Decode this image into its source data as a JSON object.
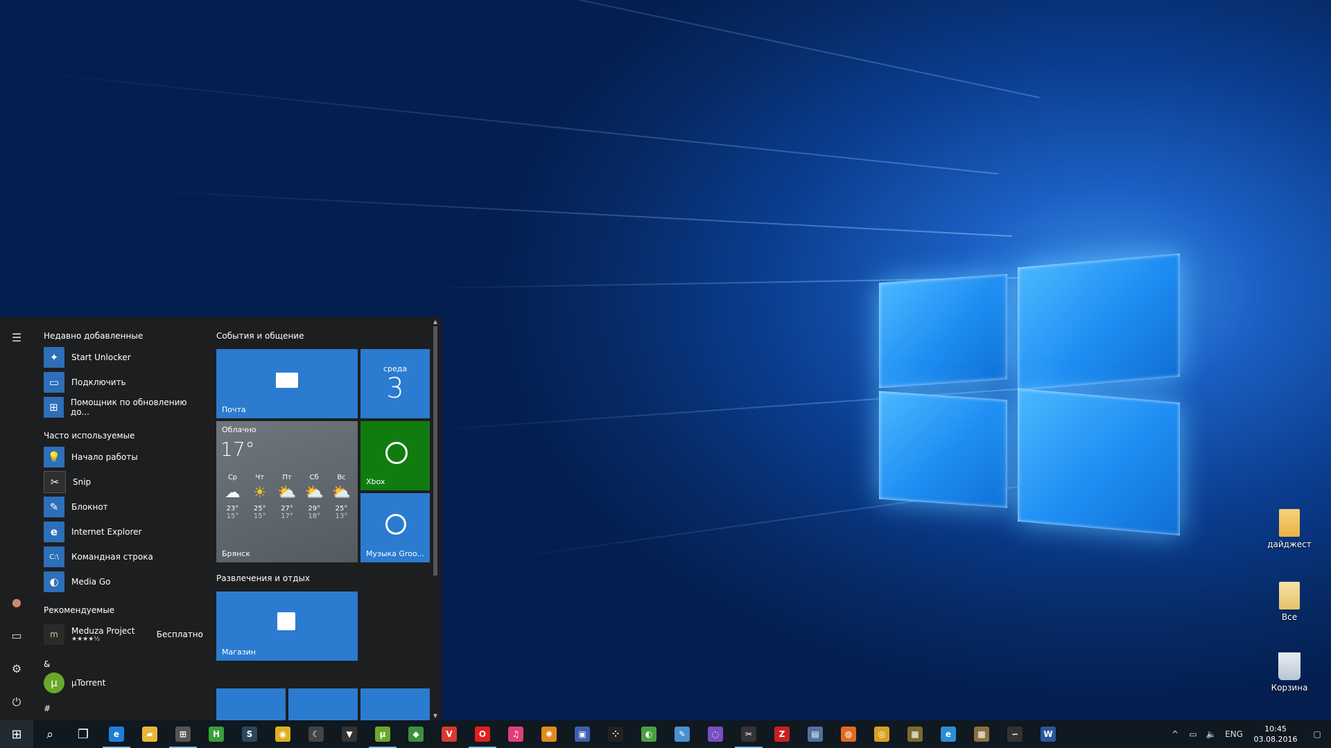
{
  "desktop": {
    "icons": [
      {
        "label": "дайджест",
        "icon": "folder-icon"
      },
      {
        "label": "Все",
        "icon": "folder-docs-icon"
      },
      {
        "label": "Корзина",
        "icon": "recycle-bin-icon"
      }
    ]
  },
  "start_menu": {
    "sections": {
      "recent": "Недавно добавленные",
      "frequent": "Часто используемые",
      "recommended": "Рекомендуемые",
      "amp": "&",
      "hash": "#"
    },
    "recent_apps": [
      {
        "label": "Start Unlocker",
        "icon": "wand-icon",
        "color": "#2d6fb8"
      },
      {
        "label": "Подключить",
        "icon": "connect-icon",
        "color": "#2d6fb8"
      },
      {
        "label": "Помощник по обновлению до...",
        "icon": "windows-icon",
        "color": "#2d6fb8"
      }
    ],
    "frequent_apps": [
      {
        "label": "Начало работы",
        "icon": "lightbulb-icon",
        "color": "#2d6fb8"
      },
      {
        "label": "Snip",
        "icon": "scissors-icon",
        "color": "#2f2f2f"
      },
      {
        "label": "Блокнот",
        "icon": "notepad-icon",
        "color": "#2d6fb8"
      },
      {
        "label": "Internet Explorer",
        "icon": "ie-icon",
        "color": "#2d6fb8"
      },
      {
        "label": "Командная строка",
        "icon": "cmd-icon",
        "color": "#2d6fb8"
      },
      {
        "label": "Media Go",
        "icon": "media-go-icon",
        "color": "#2d6fb8"
      }
    ],
    "recommended_app": {
      "label": "Meduza Project",
      "price": "Бесплатно",
      "rating": "★★★★½"
    },
    "utorrent": {
      "label": "µTorrent"
    },
    "groups": {
      "events": "События и общение",
      "entertainment": "Развлечения и отдых"
    },
    "tiles": {
      "mail": "Почта",
      "calendar_day": "среда",
      "calendar_date": "3",
      "xbox": "Xbox",
      "groove": "Музыка Groo...",
      "store": "Магазин"
    },
    "weather": {
      "condition": "Облачно",
      "temp": "17°",
      "city": "Брянск",
      "days": [
        {
          "d": "Ср",
          "hi": "23°",
          "lo": "15°",
          "icon": "cloud"
        },
        {
          "d": "Чт",
          "hi": "25°",
          "lo": "15°",
          "icon": "sun"
        },
        {
          "d": "Пт",
          "hi": "27°",
          "lo": "17°",
          "icon": "partly"
        },
        {
          "d": "Сб",
          "hi": "29°",
          "lo": "18°",
          "icon": "partly"
        },
        {
          "d": "Вс",
          "hi": "25°",
          "lo": "13°",
          "icon": "partly"
        }
      ]
    }
  },
  "taskbar": {
    "language": "ENG",
    "time": "10:45",
    "date": "03.08.2016",
    "apps": [
      {
        "name": "edge",
        "glyph": "e",
        "color": "#1e7fd8"
      },
      {
        "name": "explorer",
        "glyph": "▰",
        "color": "#e8b73a"
      },
      {
        "name": "store",
        "glyph": "⊞",
        "color": "#555"
      },
      {
        "name": "h-app",
        "glyph": "H",
        "color": "#3a9e3a"
      },
      {
        "name": "steam",
        "glyph": "S",
        "color": "#2a475e"
      },
      {
        "name": "app-duck",
        "glyph": "◉",
        "color": "#e0b020"
      },
      {
        "name": "app-crescent",
        "glyph": "☾",
        "color": "#444"
      },
      {
        "name": "app-fox",
        "glyph": "▼",
        "color": "#333"
      },
      {
        "name": "utorrent",
        "glyph": "µ",
        "color": "#6aa72b"
      },
      {
        "name": "app-green",
        "glyph": "◆",
        "color": "#3f8f3f"
      },
      {
        "name": "vivaldi",
        "glyph": "V",
        "color": "#d83b30"
      },
      {
        "name": "opera",
        "glyph": "O",
        "color": "#e0201f"
      },
      {
        "name": "itunes",
        "glyph": "♫",
        "color": "#e0407a"
      },
      {
        "name": "app-gear",
        "glyph": "✺",
        "color": "#e08a20"
      },
      {
        "name": "app-monitor",
        "glyph": "▣",
        "color": "#3a5fb0"
      },
      {
        "name": "blackberry",
        "glyph": "⁘",
        "color": "#222"
      },
      {
        "name": "media-go",
        "glyph": "◐",
        "color": "#4aa040"
      },
      {
        "name": "notepad",
        "glyph": "✎",
        "color": "#4a8fd0"
      },
      {
        "name": "tor",
        "glyph": "◌",
        "color": "#7a4fc0"
      },
      {
        "name": "snip",
        "glyph": "✂",
        "color": "#333"
      },
      {
        "name": "filezilla",
        "glyph": "Z",
        "color": "#c82020"
      },
      {
        "name": "app-doc",
        "glyph": "▤",
        "color": "#5070a0"
      },
      {
        "name": "firefox",
        "glyph": "◍",
        "color": "#e06a20"
      },
      {
        "name": "chrome",
        "glyph": "◎",
        "color": "#d8a020"
      },
      {
        "name": "app-box",
        "glyph": "▦",
        "color": "#7a6a30"
      },
      {
        "name": "ie",
        "glyph": "e",
        "color": "#2a8ed8"
      },
      {
        "name": "app-photo",
        "glyph": "▩",
        "color": "#8a7040"
      },
      {
        "name": "app-swirl",
        "glyph": "∽",
        "color": "#333"
      },
      {
        "name": "word",
        "glyph": "W",
        "color": "#2b579a"
      }
    ]
  }
}
